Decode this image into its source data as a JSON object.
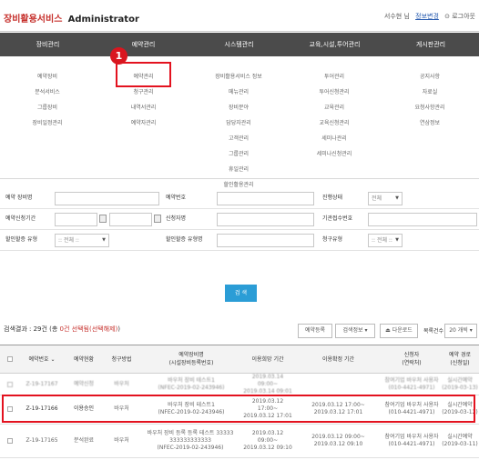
{
  "header": {
    "service_name": "장비활용서비스",
    "admin_label": "Administrator",
    "user_name": "서수현 님",
    "edit_link": "정보변경",
    "logout": "로그아웃"
  },
  "gnb": [
    "장비관리",
    "예약관리",
    "시스템관리",
    "교육,시설,투어관리",
    "게시판관리"
  ],
  "menu": {
    "col1": [
      "예약장비",
      "분석서비스",
      "그룹장비",
      "장비일정관리"
    ],
    "col2": [
      "예약관리",
      "청구관리",
      "내역서관리",
      "예약자관리"
    ],
    "col3": [
      "장비활용서비스 정보",
      "메뉴관리",
      "장비분야",
      "담당자관리",
      "고객관리",
      "그룹관리",
      "휴일관리",
      "할인활용관리",
      "예약통계"
    ],
    "col4": [
      "투어관리",
      "투어신청관리",
      "교육관리",
      "교육신청관리",
      "세미나관리",
      "세미나신청관리"
    ],
    "col5": [
      "공지사항",
      "자료실",
      "요청사항관리",
      "연삼정보"
    ]
  },
  "callout_number": "1",
  "search": {
    "equip_label": "예약 장비명",
    "resv_no_label": "예약번호",
    "status_label": "진행상태",
    "status_value": "전체",
    "period_label": "예약신청기간",
    "applicant_label": "신청자명",
    "org_label": "기관접수번호",
    "discount_label": "할인할증 유형",
    "discount_value": ":: 전체 ::",
    "discount_type_label": "할인할증 유형명",
    "billing_label": "청구유형",
    "billing_value": ":: 전체 ::",
    "button": "검 색"
  },
  "results": {
    "prefix": "검색결과 : 29건 (총 ",
    "selected": "0건 선택됨",
    "clear": "(선택해제)",
    "suffix": ")",
    "btn_register": "예약등록",
    "btn_print": "검색정보",
    "btn_download": "다운로드",
    "per_page_label": "목록건수",
    "per_page_value": "20 개씩"
  },
  "table": {
    "headers": [
      "예약번호",
      "예약현황",
      "청구방법",
      "예약장비명\n(시설장비등록번호)",
      "이용희망 기간",
      "이용확정 기간",
      "신청자\n(연락처)",
      "예약 경로\n(신청일)"
    ],
    "rows": [
      {
        "no": "Z-19-17167",
        "status": "예약신청",
        "billing": "바우처",
        "equip": "바우처 장비 테스트1\n(NFEC-2019-02-243946)",
        "hope": "2019.03.14 09:00~\n2019.03.14 09:01",
        "confirm": "",
        "applicant": "참여기업 바우처 사용자\n(010-4421-4971)",
        "route": "실시간예약\n(2019-03-13)"
      },
      {
        "no": "Z-19-17166",
        "status": "이용승인",
        "billing": "바우처",
        "equip": "바우처 장비 테스트1\n(NFEC-2019-02-243946)",
        "hope": "2019.03.12 17:00~\n2019.03.12 17:01",
        "confirm": "2019.03.12 17:00~\n2019.03.12 17:01",
        "applicant": "참여기업 바우처 사용자\n(010-4421-4971)",
        "route": "실시간예약\n(2019-03-12)"
      },
      {
        "no": "Z-19-17165",
        "status": "분석완료",
        "billing": "바우처",
        "equip": "바우처 장비 등록 등록 테스트 33333\n333333333333\n(NFEC-2019-02-243946)",
        "hope": "2019.03.12 09:00~\n2019.03.12 09:10",
        "confirm": "2019.03.12 09:00~\n2019.03.12 09:10",
        "applicant": "참여기업 바우처 사용자\n(010-4421-4971)",
        "route": "실시간예약\n(2019-03-11)"
      }
    ]
  }
}
